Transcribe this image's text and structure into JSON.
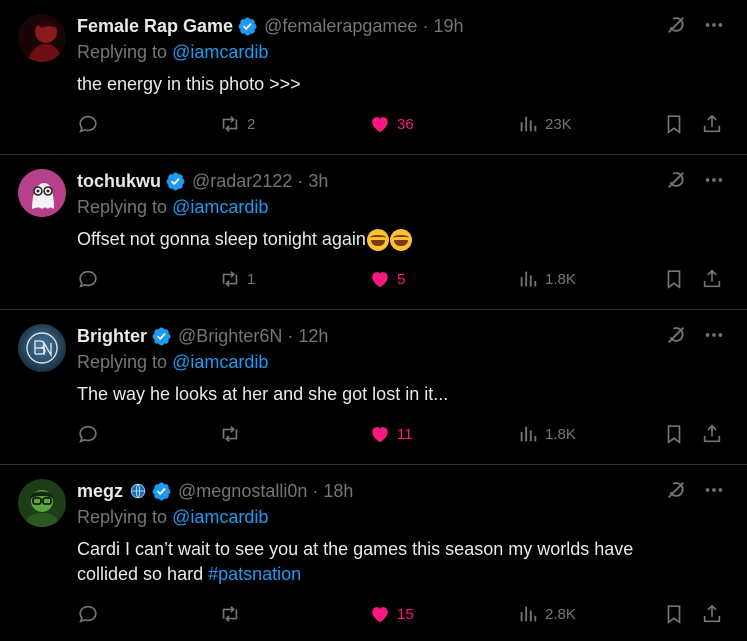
{
  "tweets": [
    {
      "name": "Female Rap Game",
      "handle": "@femalerapgamee",
      "time": "19h",
      "replying_prefix": "Replying to ",
      "replying_to": "@iamcardib",
      "text": "the energy in this photo >>>",
      "replies": "",
      "retweets": "2",
      "likes": "36",
      "views": "23K",
      "avatar_color": "#6b0f12"
    },
    {
      "name": "tochukwu",
      "handle": "@radar2122",
      "time": "3h",
      "replying_prefix": "Replying to ",
      "replying_to": "@iamcardib",
      "text": "Offset not gonna sleep tonight again",
      "emojis": [
        "face-with-tears-of-joy",
        "face-with-tears-of-joy"
      ],
      "replies": "",
      "retweets": "1",
      "likes": "5",
      "views": "1.8K",
      "avatar_color": "#b83f8a"
    },
    {
      "name": "Brighter",
      "handle": "@Brighter6N",
      "time": "12h",
      "replying_prefix": "Replying to ",
      "replying_to": "@iamcardib",
      "text": "The way he looks at her and she got lost in it...",
      "replies": "",
      "retweets": "",
      "likes": "11",
      "views": "1.8K",
      "avatar_color": "#2a4a66"
    },
    {
      "name": "megz",
      "handle": "@megnostalli0n",
      "time": "18h",
      "replying_prefix": "Replying to ",
      "replying_to": "@iamcardib",
      "text": "Cardi I can’t wait to see you at the games this season my worlds have collided so hard ",
      "hashtag": "#patsnation",
      "replies": "",
      "retweets": "",
      "likes": "15",
      "views": "2.8K",
      "avatar_color": "#3d7a2a"
    }
  ],
  "colors": {
    "background": "#000000",
    "text": "#e7e9ea",
    "muted": "#71767b",
    "link": "#1d9bf0",
    "like": "#f91880",
    "divider": "#2f3336"
  }
}
